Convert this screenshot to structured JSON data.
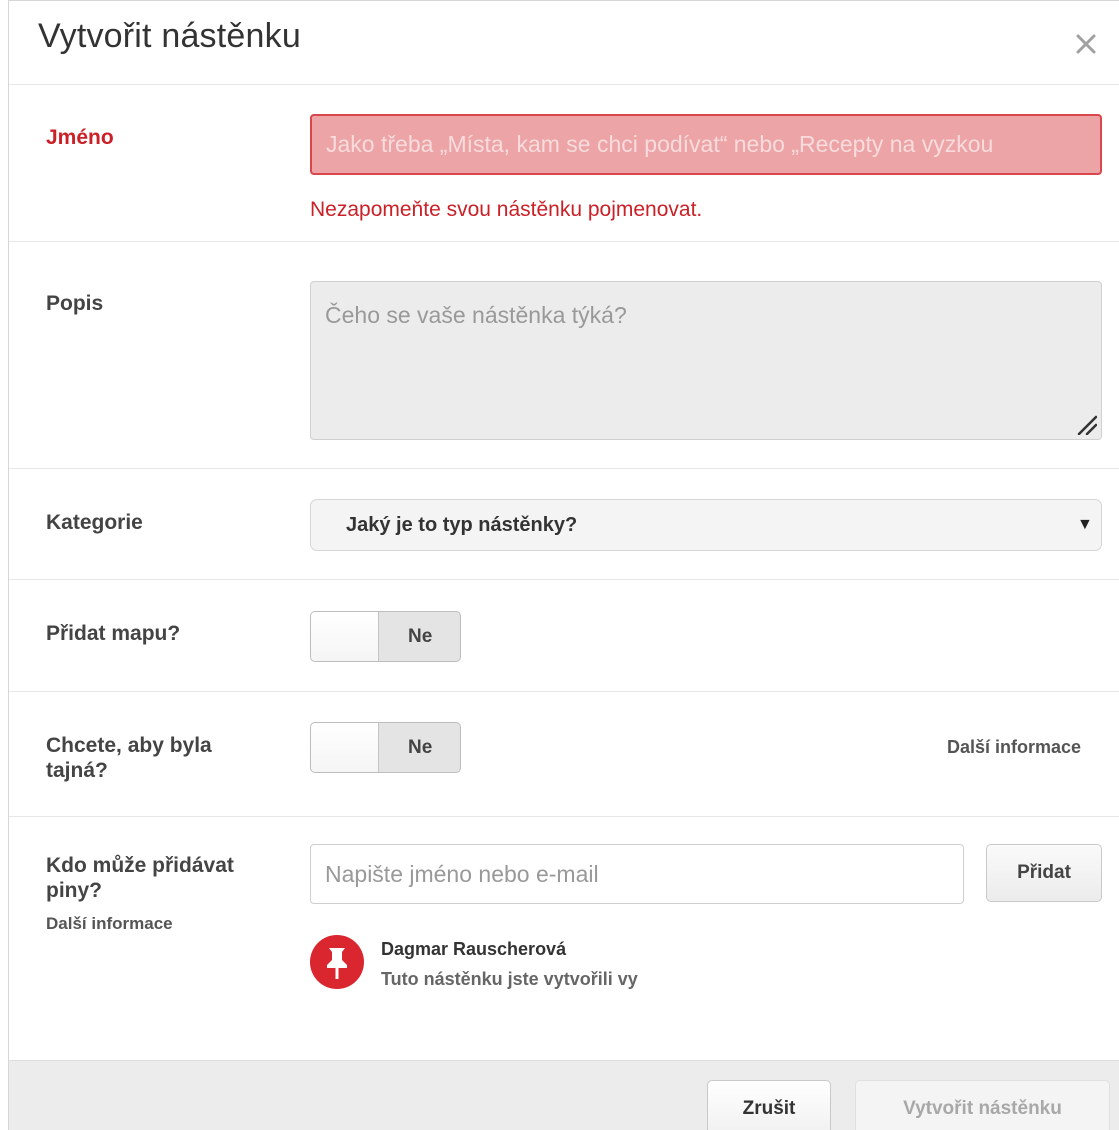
{
  "dialog": {
    "title": "Vytvořit nástěnku",
    "close_icon": "close-icon"
  },
  "name": {
    "label": "Jméno",
    "placeholder": "Jako třeba „Místa, kam se chci podívat“ nebo „Recepty na vyzkou",
    "value": "",
    "error": "Nezapomeňte svou nástěnku pojmenovat.",
    "error_color": "#cb2027"
  },
  "description": {
    "label": "Popis",
    "placeholder": "Čeho se vaše nástěnka týká?",
    "value": ""
  },
  "category": {
    "label": "Kategorie",
    "selected": "Jaký je to typ nástěnky?",
    "arrow": "▼"
  },
  "map": {
    "label": "Přidat mapu?",
    "toggle_label": "Ne",
    "state": "off"
  },
  "secret": {
    "label": "Chcete, aby byla tajná?",
    "toggle_label": "Ne",
    "state": "off",
    "more_info": "Další informace"
  },
  "collaborators": {
    "label": "Kdo může přidávat piny?",
    "more_info": "Další informace",
    "placeholder": "Napište jméno nebo e-mail",
    "value": "",
    "add_button": "Přidat",
    "owner": {
      "name": "Dagmar Rauscherová",
      "note": "Tuto nástěnku jste vytvořili vy",
      "avatar_icon": "pushpin-icon",
      "avatar_color": "#d9262f"
    }
  },
  "footer": {
    "cancel": "Zrušit",
    "create": "Vytvořit nástěnku"
  }
}
